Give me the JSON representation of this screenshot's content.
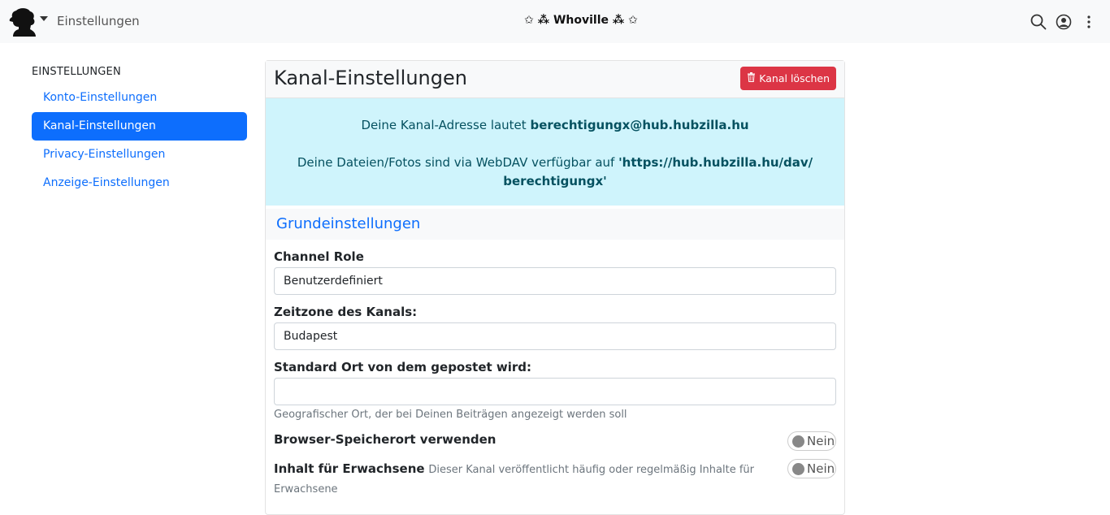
{
  "navbar": {
    "title": "Einstellungen",
    "site_name": "✩ ⁂ Whoville ⁂ ✩",
    "icons": [
      "search-icon",
      "user-circle-icon",
      "more-vertical-icon"
    ]
  },
  "sidebar": {
    "heading": "EINSTELLUNGEN",
    "items": [
      {
        "label": "Konto-Einstellungen"
      },
      {
        "label": "Kanal-Einstellungen"
      },
      {
        "label": "Privacy-Einstellungen"
      },
      {
        "label": "Anzeige-Einstellungen"
      }
    ]
  },
  "main": {
    "title": "Kanal-Einstellungen",
    "delete_button": "Kanal löschen",
    "info": {
      "address_prefix": "Deine Kanal-Adresse lautet ",
      "address": "berechtigungx@hub.hubzilla.hu",
      "webdav_prefix": "Deine Dateien/Fotos sind via WebDAV verfügbar auf ",
      "webdav_url": "'https://hub.hubzilla.hu/dav/ berechtigungx'"
    },
    "section": "Grundeinstellungen",
    "fields": {
      "role_label": "Channel Role",
      "role_value": "Benutzerdefiniert",
      "timezone_label": "Zeitzone des Kanals:",
      "timezone_value": "Budapest",
      "location_label": "Standard Ort von dem gepostet wird:",
      "location_value": "",
      "location_help": "Geografischer Ort, der bei Deinen Beiträgen angezeigt werden soll",
      "browser_location_label": "Browser-Speicherort verwenden",
      "browser_location_value": "Nein",
      "adult_label": "Inhalt für Erwachsene",
      "adult_desc": "Dieser Kanal veröffentlicht häufig oder regelmäßig Inhalte für Erwachsene",
      "adult_value": "Nein"
    }
  },
  "colors": {
    "primary": "#0d6efd",
    "danger": "#dc3545",
    "info_bg": "#cff4fc",
    "info_text": "#055160"
  }
}
